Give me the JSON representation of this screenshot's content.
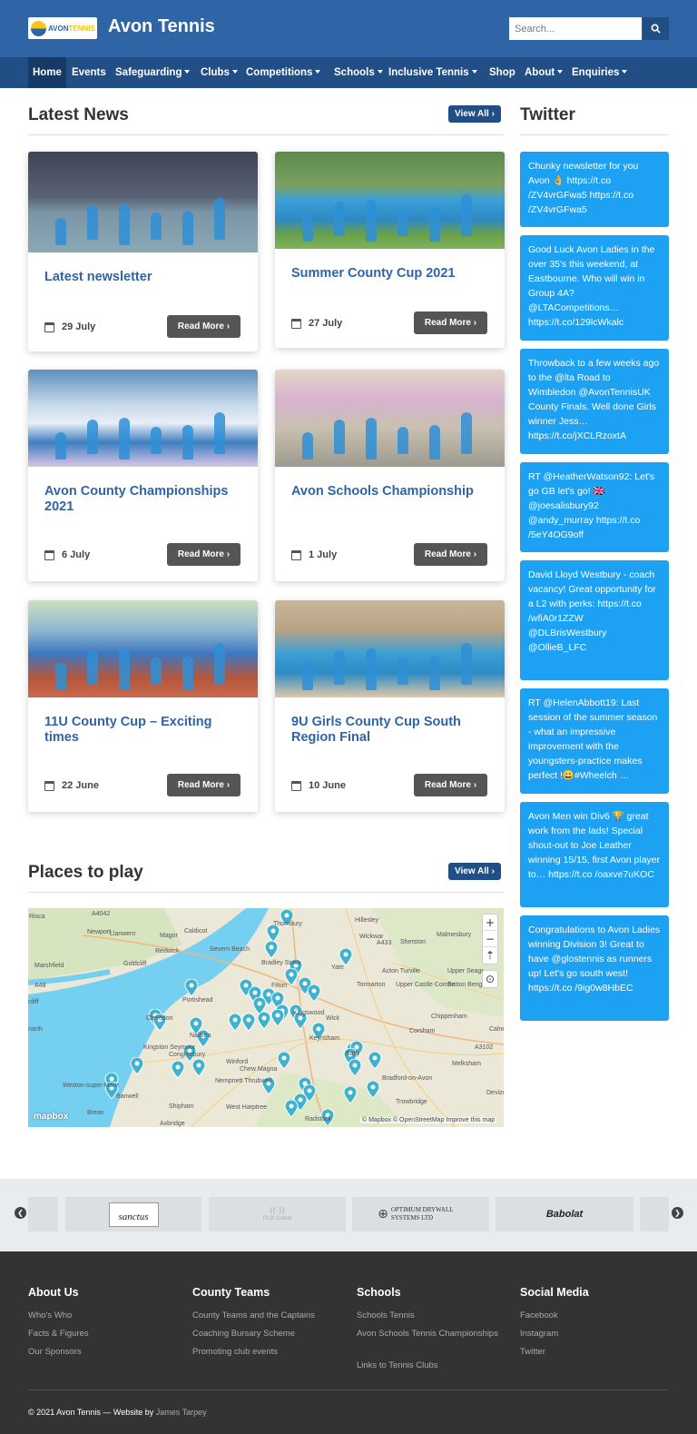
{
  "header": {
    "logo_text_1": "AVON",
    "logo_text_2": "TENNIS",
    "site_title": "Avon Tennis",
    "search_placeholder": "Search...",
    "search_icon": "search-icon"
  },
  "nav": {
    "items": [
      {
        "label": "Home",
        "dropdown": false
      },
      {
        "label": "Events",
        "dropdown": false
      },
      {
        "label": "Safeguarding",
        "dropdown": true
      },
      {
        "label": "Clubs",
        "dropdown": true
      },
      {
        "label": "Competitions",
        "dropdown": true
      },
      {
        "label": "Schools",
        "dropdown": true
      },
      {
        "label": "Inclusive Tennis",
        "dropdown": true
      },
      {
        "label": "Shop",
        "dropdown": false
      },
      {
        "label": "About",
        "dropdown": true
      },
      {
        "label": "Enquiries",
        "dropdown": true
      }
    ]
  },
  "news": {
    "title": "Latest News",
    "view_all": "View All",
    "read_more": "Read More",
    "items": [
      {
        "title": "Latest newsletter",
        "date": "29 July"
      },
      {
        "title": "Summer County Cup 2021",
        "date": "27 July"
      },
      {
        "title": "Avon County Championships 2021",
        "date": "6 July"
      },
      {
        "title": "Avon Schools Championship",
        "date": "1 July"
      },
      {
        "title": "11U County Cup – Exciting times",
        "date": "22 June"
      },
      {
        "title": "9U Girls County Cup South Region Final",
        "date": "10 June"
      }
    ]
  },
  "twitter": {
    "title": "Twitter",
    "tweets": [
      "Chunky newsletter for you Avon 👌 https://t.co /ZV4vrGFwa5 https://t.co /ZV4vrGFwa5",
      "Good Luck Avon Ladies in the over 35's this weekend, at Eastbourne. Who will win in Group 4A? @LTACompetitions… https://t.co/129lcWkalc",
      "Throwback to a few weeks ago to the @lta Road to Wimbledon @AvonTennisUK County Finals. Well done Girls winner Jess… https://t.co/jXCLRzoxtA",
      "RT @HeatherWatson92: Let's go GB let's go! 🇬🇧 @joesalisbury92 @andy_murray https://t.co /5eY4OG9off",
      "David Lloyd Westbury - coach vacancy! Great opportunity for a L2 with perks: https://t.co /wfiA0r1ZZW @DLBrisWestbury @OllieB_LFC",
      "RT @HelenAbbott19: Last session of the summer season - what an impressive improvement with the youngsters-practice makes perfect !😀#Wheelch …",
      "Avon Men win Div6 🏆 great work from the lads! Special shout-out to Joe Leather winning 15/15, first Avon player to… https://t.co /oaxve7uKOC",
      "Congratulations to Avon Ladies winning Division 3! Great to have @glostennis as runners up! Let's go south west! https://t.co /9ig0w8HbEC"
    ]
  },
  "places": {
    "title": "Places to play",
    "view_all": "View All",
    "map_attribution": "© Mapbox © OpenStreetMap Improve this map",
    "mapbox_logo": "mapbox",
    "zoom_in": "+",
    "zoom_out": "−",
    "compass": "⇡",
    "locate": "⊙",
    "labels": [
      "Risca",
      "A4042",
      "Newport",
      "Llanwern",
      "Magor",
      "Caldicot",
      "Thornbury",
      "Hillesley",
      "Wickwar",
      "Sherston",
      "Malmesbury",
      "Marshfield",
      "Goldcliff",
      "Redwick",
      "Severn Beach",
      "A433",
      "Yate",
      "A48",
      "rdiff",
      "Portishead",
      "Acton Turville",
      "Upper Seagr",
      "Tormarton",
      "Upper Castle Combe",
      "Sutton Benger",
      "Chippenham",
      "narth",
      "Clevedon",
      "Wick",
      "Corsham",
      "Calne",
      "Keynsham",
      "Nailsea",
      "Kingston Seymour",
      "Congresbury",
      "Winford",
      "A3102",
      "Melksham",
      "Chew Magna",
      "Bradford-on-Avon",
      "Weston-super-Mare",
      "Banwell",
      "Nempnett Thrubwell",
      "Trowbridge",
      "Brean",
      "Shipham",
      "West Harptree",
      "Devizes",
      "Axbridge",
      "Radstock",
      "Bradley Stoke",
      "Filton",
      "Kingswood",
      "Bath"
    ]
  },
  "sponsors": {
    "items": [
      "sanctus",
      "PLM Global",
      "OPTIMUM DRYWALL SYSTEMS LTD",
      "Babolat"
    ]
  },
  "footer": {
    "columns": [
      {
        "heading": "About Us",
        "links": [
          "Who's Who",
          "Facts & Figures",
          "Our Sponsors"
        ]
      },
      {
        "heading": "County Teams",
        "links": [
          "County Teams and the Captains",
          "Coaching Bursary Scheme",
          "Promoting club events"
        ]
      },
      {
        "heading": "Schools",
        "links": [
          "Schools Tennis",
          "Avon Schools Tennis Championships",
          "Links to Tennis Clubs"
        ]
      },
      {
        "heading": "Social Media",
        "links": [
          "Facebook",
          "Instagram",
          "Twitter"
        ]
      }
    ],
    "copyright": "© 2021 Avon Tennis — Website by",
    "author": "James Tarpey"
  },
  "colors": {
    "primary": "#2f65a7",
    "nav": "#214e85",
    "tweet": "#1da1f2",
    "footer": "#333333",
    "marker": "#3eb2cf"
  }
}
